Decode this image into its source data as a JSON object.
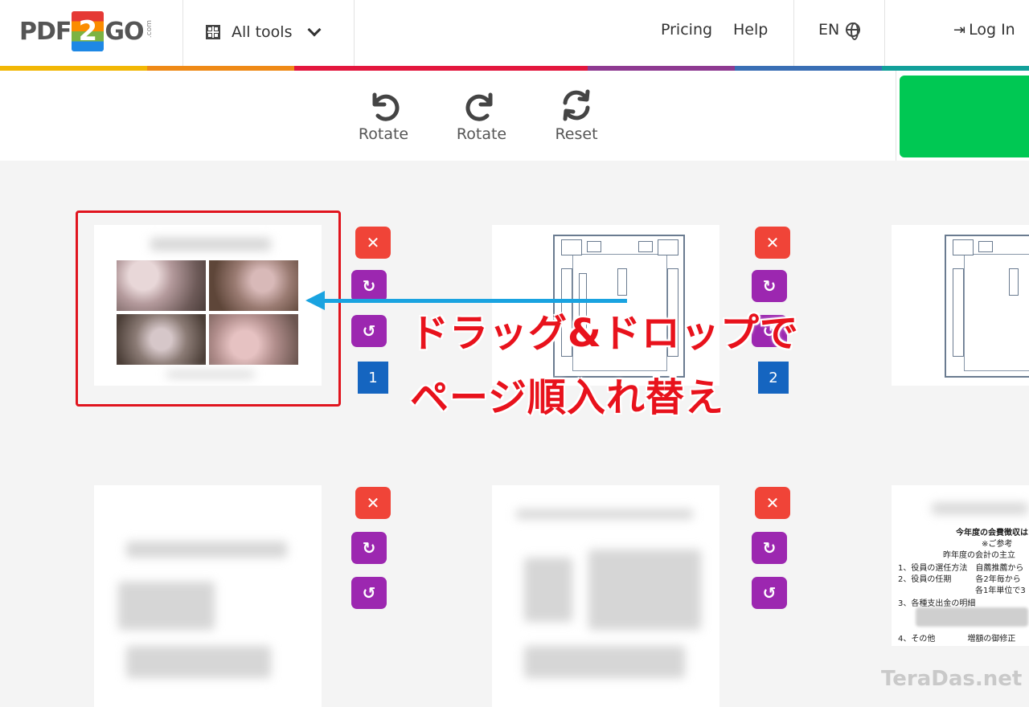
{
  "header": {
    "logo": {
      "left": "PDF",
      "middle": "2",
      "right": "GO",
      "suffix": ".com"
    },
    "all_tools_label": "All tools",
    "nav": {
      "pricing": "Pricing",
      "help": "Help"
    },
    "language": "EN",
    "login": "Log In",
    "rainbow_colors": [
      "#f2b705",
      "#ef8a17",
      "#e3173e",
      "#e3173e",
      "#8e3a91",
      "#3a6fb5",
      "#12a09a"
    ]
  },
  "toolbar": {
    "rotate_left_label": "Rotate",
    "rotate_right_label": "Rotate",
    "reset_label": "Reset",
    "action_color": "#00c853"
  },
  "pages": [
    {
      "number": "1",
      "delete": "✕",
      "rotate_right": "↻",
      "rotate_left": "↺"
    },
    {
      "number": "2",
      "delete": "✕",
      "rotate_right": "↻",
      "rotate_left": "↺"
    }
  ],
  "row2_buttons": {
    "delete": "✕",
    "rotate_right": "↻",
    "rotate_left": "↺"
  },
  "annotation": {
    "line1": "ドラッグ&ドロップで",
    "line2": "ページ順入れ替え",
    "color": "#e8121c",
    "arrow_color": "#1aa3e0"
  },
  "doc_page": {
    "title": "今年度の会費徴収はござ",
    "subtitle": "※ご参考",
    "line_a": "昨年度の会計の主立",
    "item1": "1、役員の選任方法　自薦推薦から",
    "item2": "2、役員の任期　　　各2年毎から",
    "item2b": "各1年単位で3",
    "item3": "3、各種支出金の明細",
    "item4": "4、その他　　　　増額の御修正"
  },
  "watermark": "TeraDas.net"
}
